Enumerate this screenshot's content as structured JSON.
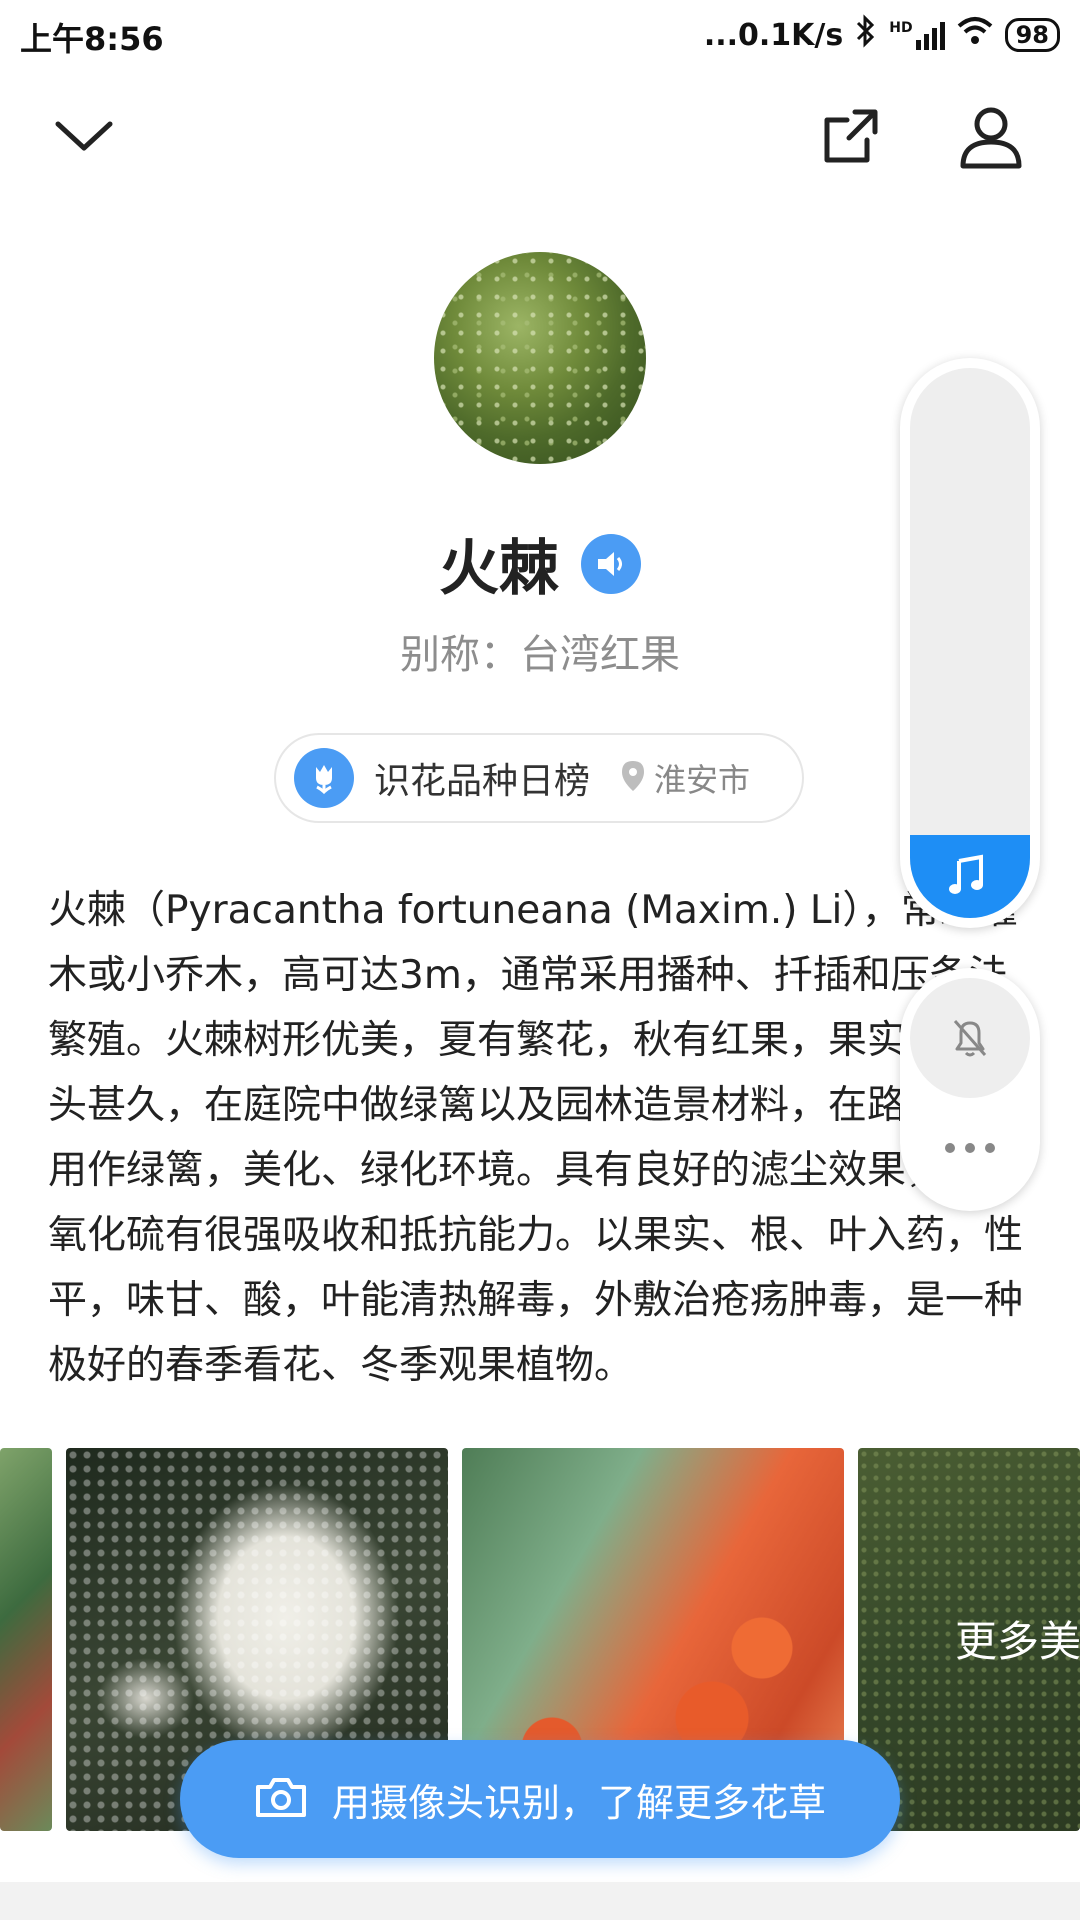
{
  "status_bar": {
    "time": "上午8:56",
    "network_speed": "...0.1K/s",
    "network_type": "HD",
    "battery": "98",
    "icons": [
      "bluetooth-icon",
      "signal-icon",
      "wifi-icon",
      "battery-icon"
    ]
  },
  "header": {
    "collapse_icon": "chevron-down-icon",
    "share_icon": "share-icon",
    "user_icon": "user-icon"
  },
  "plant": {
    "name": "火棘",
    "alias": "别称：台湾红果",
    "description": "火棘（Pyracantha fortuneana (Maxim.) Li），常绿灌木或小乔木，高可达3m，通常采用播种、扦插和压条法繁殖。火棘树形优美，夏有繁花，秋有红果，果实存留枝头甚久，在庭院中做绿篱以及园林造景材料，在路边可以用作绿篱，美化、绿化环境。具有良好的滤尘效果，对二氧化硫有很强吸收和抵抗能力。以果实、根、叶入药，性平，味甘、酸，叶能清热解毒，外敷治疮疡肿毒，是一种极好的春季看花、冬季观果植物。"
  },
  "rank": {
    "label": "识花品种日榜",
    "city": "淮安市"
  },
  "gallery": {
    "more_label": "更多美图"
  },
  "cta": {
    "label": "用摄像头识别，了解更多花草"
  },
  "colors": {
    "accent": "#4b9cf4",
    "player_fill": "#1e8ef5",
    "text": "#222222",
    "muted": "#8d8d8d"
  },
  "player": {
    "progress": 0.15
  }
}
